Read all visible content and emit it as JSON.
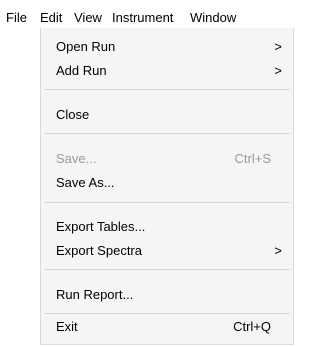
{
  "menubar": {
    "items": [
      {
        "label": "File"
      },
      {
        "label": "Edit"
      },
      {
        "label": "View"
      },
      {
        "label": "Instrument"
      },
      {
        "label": "Window"
      }
    ]
  },
  "file_menu": {
    "items": [
      {
        "label": "Open Run",
        "submenu_glyph": ">"
      },
      {
        "label": "Add Run",
        "submenu_glyph": ">"
      },
      {
        "label": "Close"
      },
      {
        "label": "Save...",
        "shortcut": "Ctrl+S",
        "enabled": false
      },
      {
        "label": "Save As..."
      },
      {
        "label": "Export Tables..."
      },
      {
        "label": "Export Spectra",
        "submenu_glyph": ">"
      },
      {
        "label": "Run Report..."
      },
      {
        "label": "Exit",
        "shortcut": "Ctrl+Q"
      }
    ]
  }
}
